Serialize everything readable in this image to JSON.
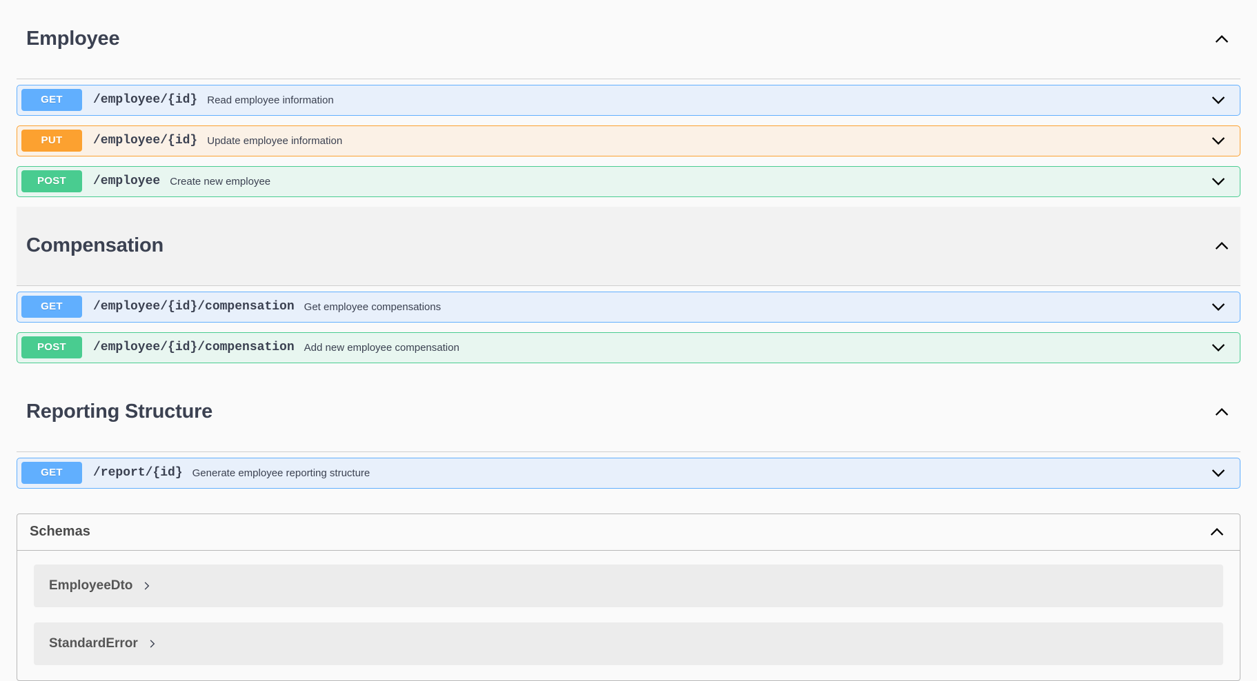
{
  "colors": {
    "page_bg": "#fafafa",
    "get": "#61affe",
    "get_bg": "#e8f0fb",
    "put": "#fca130",
    "put_bg": "#fbf1e6",
    "post": "#49cc90",
    "post_bg": "#e8f6f0",
    "text": "#3b4151",
    "schema_row_bg": "#ececec"
  },
  "tags": [
    {
      "title": "Employee",
      "expanded": true,
      "toggle_icon": "chevron-up-icon",
      "hovered": false,
      "operations": [
        {
          "method": "GET",
          "method_key": "get",
          "path": "/employee/{id}",
          "summary": "Read employee information",
          "toggle_icon": "chevron-down-icon"
        },
        {
          "method": "PUT",
          "method_key": "put",
          "path": "/employee/{id}",
          "summary": "Update employee information",
          "toggle_icon": "chevron-down-icon"
        },
        {
          "method": "POST",
          "method_key": "post",
          "path": "/employee",
          "summary": "Create new employee",
          "toggle_icon": "chevron-down-icon"
        }
      ]
    },
    {
      "title": "Compensation",
      "expanded": true,
      "toggle_icon": "chevron-up-icon",
      "hovered": true,
      "operations": [
        {
          "method": "GET",
          "method_key": "get",
          "path": "/employee/{id}/compensation",
          "summary": "Get employee compensations",
          "toggle_icon": "chevron-down-icon"
        },
        {
          "method": "POST",
          "method_key": "post",
          "path": "/employee/{id}/compensation",
          "summary": "Add new employee compensation",
          "toggle_icon": "chevron-down-icon"
        }
      ]
    },
    {
      "title": "Reporting Structure",
      "expanded": true,
      "toggle_icon": "chevron-up-icon",
      "hovered": false,
      "operations": [
        {
          "method": "GET",
          "method_key": "get",
          "path": "/report/{id}",
          "summary": "Generate employee reporting structure",
          "toggle_icon": "chevron-down-icon"
        }
      ]
    }
  ],
  "schemas": {
    "title": "Schemas",
    "expanded": true,
    "toggle_icon": "chevron-up-icon",
    "items": [
      {
        "name": "EmployeeDto",
        "expand_icon": "chevron-right-icon"
      },
      {
        "name": "StandardError",
        "expand_icon": "chevron-right-icon"
      }
    ]
  }
}
